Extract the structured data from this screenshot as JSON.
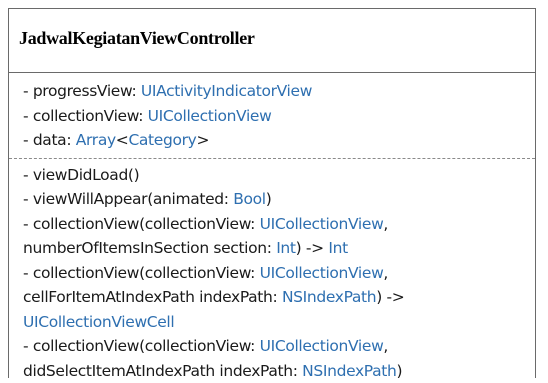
{
  "class_name": "JadwalKegiatanViewController",
  "attributes": [
    [
      {
        "t": "- progressView: "
      },
      {
        "t": "UIActivityIndicatorView",
        "type": true
      }
    ],
    [
      {
        "t": "- collectionView: "
      },
      {
        "t": "UICollectionView",
        "type": true
      }
    ],
    [
      {
        "t": "- data: "
      },
      {
        "t": "Array",
        "type": true
      },
      {
        "t": "<"
      },
      {
        "t": "Category",
        "type": true
      },
      {
        "t": ">"
      }
    ]
  ],
  "methods": [
    [
      {
        "t": "- viewDidLoad()"
      }
    ],
    [
      {
        "t": "- viewWillAppear(animated: "
      },
      {
        "t": "Bool",
        "type": true
      },
      {
        "t": ")"
      }
    ],
    [
      {
        "t": "- collectionView(collectionView: "
      },
      {
        "t": "UICollectionView",
        "type": true
      },
      {
        "t": ","
      }
    ],
    [
      {
        "t": "numberOfItemsInSection section: "
      },
      {
        "t": "Int",
        "type": true
      },
      {
        "t": ") -> "
      },
      {
        "t": "Int",
        "type": true
      }
    ],
    [
      {
        "t": "- collectionView(collectionView: "
      },
      {
        "t": "UICollectionView",
        "type": true
      },
      {
        "t": ","
      }
    ],
    [
      {
        "t": "cellForItemAtIndexPath indexPath: "
      },
      {
        "t": "NSIndexPath",
        "type": true
      },
      {
        "t": ") ->"
      }
    ],
    [
      {
        "t": "UICollectionViewCell",
        "type": true
      }
    ],
    [
      {
        "t": "- collectionView(collectionView: "
      },
      {
        "t": "UICollectionView",
        "type": true
      },
      {
        "t": ","
      }
    ],
    [
      {
        "t": "didSelectItemAtIndexPath indexPath: "
      },
      {
        "t": "NSIndexPath",
        "type": true
      },
      {
        "t": ")"
      }
    ]
  ],
  "colors": {
    "type_color": "#2e6fb0",
    "text_color": "#1a1a1a",
    "border_color": "#6a6a6a"
  }
}
